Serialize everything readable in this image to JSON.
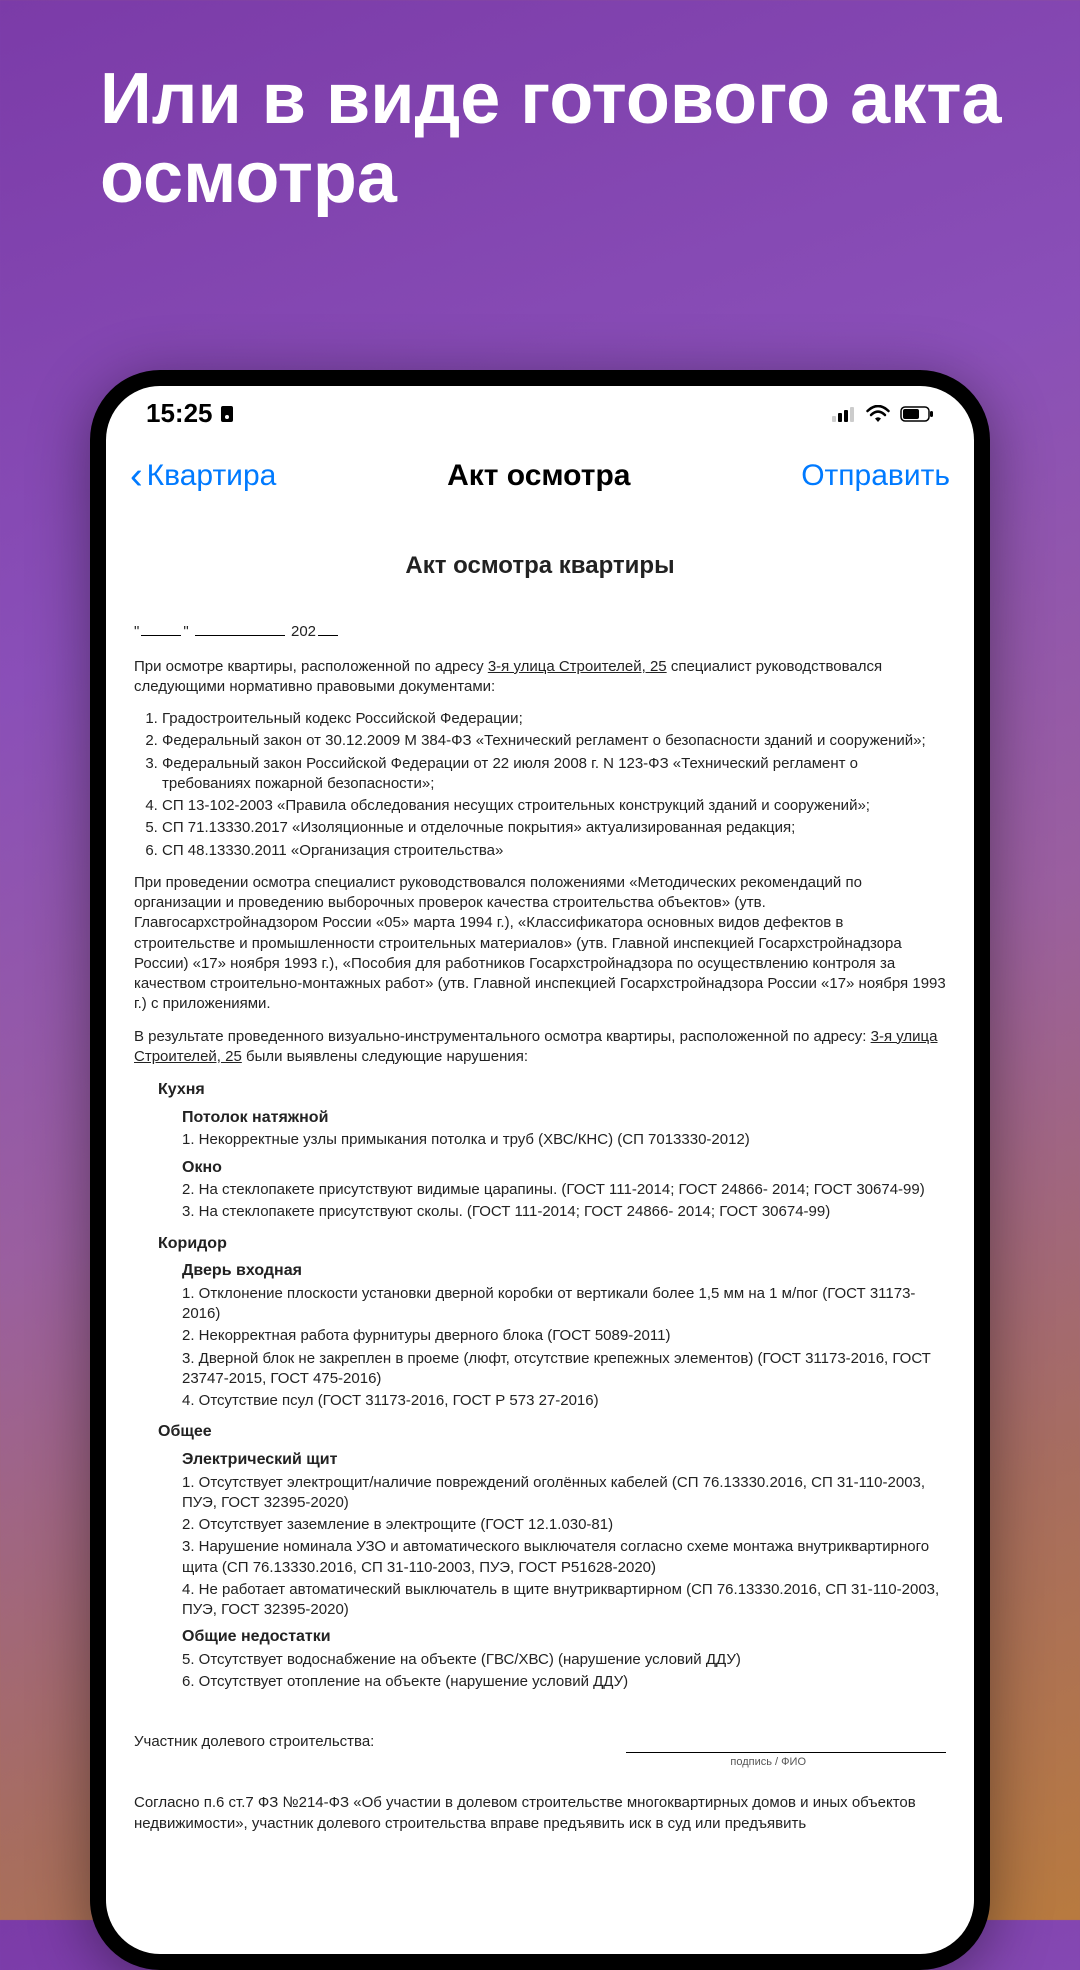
{
  "headline": "Или в виде готового акта осмотра",
  "status": {
    "time": "15:25"
  },
  "nav": {
    "back": "Квартира",
    "title": "Акт осмотра",
    "action": "Отправить"
  },
  "doc": {
    "title": "Акт осмотра квартиры",
    "date_year_prefix": "202",
    "intro_1": "При осмотре квартиры, расположенной по адресу ",
    "intro_addr": "3-я улица Строителей, 25",
    "intro_2": " специалист руководствовался следующими нормативно правовыми документами:",
    "laws": [
      "Градостроительный кодекс Российской Федерации;",
      "Федеральный закон от 30.12.2009 М 384-ФЗ «Технический регламент о безопасности зданий и сооружений»;",
      "Федеральный закон Российской Федерации от 22 июля 2008 г. N 123-ФЗ «Технический регламент о требованиях пожарной безопасности»;",
      "СП 13-102-2003 «Правила обследования несущих строительных конструкций зданий и сооружений»;",
      "СП 71.13330.2017 «Изоляционные и отделочные покрытия» актуализированная редакция;",
      "СП 48.13330.2011 «Организация строительства»"
    ],
    "method": "При проведении осмотра специалист руководствовался положениями «Методических рекомендаций по организации и проведению выборочных проверок качества строительства объектов» (утв. Главгосархстройнадзором России «05» марта 1994 г.), «Классификатора основных видов дефектов в строительстве и промышленности строительных материалов» (утв. Главной инспекцией Госархстройнадзора России) «17» ноября 1993 г.), «Пособия для работников Госархстройнадзора по осуществлению контроля за качеством строительно-монтажных работ» (утв. Главной инспекцией Госархстройнадзора России «17» ноября 1993 г.) с приложениями.",
    "result_1": "В результате проведенного визуально-инструментального осмотра квартиры, расположенной по адресу: ",
    "result_addr": "3-я улица Строителей, 25",
    "result_2": " были выявлены следующие нарушения:",
    "rooms": [
      {
        "name": "Кухня",
        "subs": [
          {
            "name": "Потолок натяжной",
            "defects": [
              "1. Некорректные узлы примыкания потолка и труб (ХВС/КНС) (СП 7013330-2012)"
            ]
          },
          {
            "name": "Окно",
            "defects": [
              "2. На стеклопакете присутствуют видимые царапины. (ГОСТ 111-2014; ГОСТ 24866- 2014; ГОСТ 30674-99)",
              "3. На стеклопакете присутствуют сколы. (ГОСТ 111-2014; ГОСТ 24866- 2014; ГОСТ 30674-99)"
            ]
          }
        ]
      },
      {
        "name": "Коридор",
        "subs": [
          {
            "name": "Дверь входная",
            "defects": [
              "1. Отклонение плоскости установки дверной коробки от вертикали более 1,5 мм на 1 м/пог (ГОСТ 31173-2016)",
              "2. Некорректная работа фурнитуры дверного блока (ГОСТ 5089-2011)",
              "3. Дверной блок не закреплен в проеме (люфт, отсутствие крепежных элементов) (ГОСТ 31173-2016, ГОСТ 23747-2015, ГОСТ 475-2016)",
              "4. Отсутствие псул (ГОСТ 31173-2016, ГОСТ Р 573 27-2016)"
            ]
          }
        ]
      },
      {
        "name": "Общее",
        "subs": [
          {
            "name": "Электрический щит",
            "defects": [
              "1. Отсутствует электрощит/наличие повреждений оголённых кабелей (СП 76.13330.2016, СП 31-110-2003, ПУЭ, ГОСТ 32395-2020)",
              "2. Отсутствует заземление в электрощите (ГОСТ 12.1.030-81)",
              "3. Нарушение номинала УЗО и автоматического выключателя согласно схеме монтажа внутриквартирного щита (СП 76.13330.2016, СП 31-110-2003, ПУЭ, ГОСТ Р51628-2020)",
              "4. Не работает автоматический выключатель в щите внутриквартирном (СП 76.13330.2016, СП 31-110-2003, ПУЭ, ГОСТ 32395-2020)"
            ]
          },
          {
            "name": "Общие недостатки",
            "defects": [
              "5. Отсутствует водоснабжение на объекте (ГВС/ХВС) (нарушение условий ДДУ)",
              "6. Отсутствует отопление на объекте (нарушение условий ДДУ)"
            ]
          }
        ]
      }
    ],
    "signature_label": "Участник долевого строительства:",
    "signature_caption": "подпись / ФИО",
    "legal": "Согласно п.6 ст.7 ФЗ №214-ФЗ «Об участии в долевом строительстве многоквартирных домов и иных объектов недвижимости», участник долевого строительства вправе предъявить иск в суд или предъявить"
  }
}
